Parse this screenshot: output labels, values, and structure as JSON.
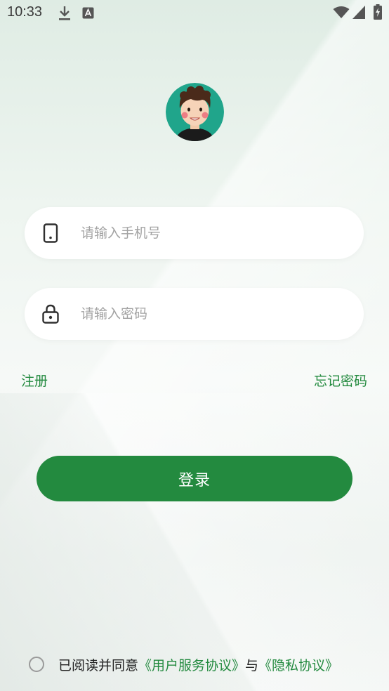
{
  "status_bar": {
    "time": "10:33",
    "icons": [
      "download-icon",
      "text-notification-icon",
      "wifi-icon",
      "signal-icon",
      "battery-charging-icon"
    ]
  },
  "avatar": {
    "icon": "avatar-cartoon-boy"
  },
  "phone_field": {
    "placeholder": "请输入手机号",
    "value": "",
    "icon": "phone-icon"
  },
  "password_field": {
    "placeholder": "请输入密码",
    "value": "",
    "icon": "lock-icon"
  },
  "links": {
    "register": "注册",
    "forgot_password": "忘记密码"
  },
  "login_button": {
    "label": "登录"
  },
  "agreement": {
    "checked": false,
    "prefix": "已阅读并同意",
    "user_agreement": "《用户服务协议》",
    "conjunction": "与",
    "privacy_policy": "《隐私协议》"
  },
  "colors": {
    "primary": "#238a3f",
    "avatar_bg": "#20a58b",
    "placeholder": "#a3a3a3"
  }
}
